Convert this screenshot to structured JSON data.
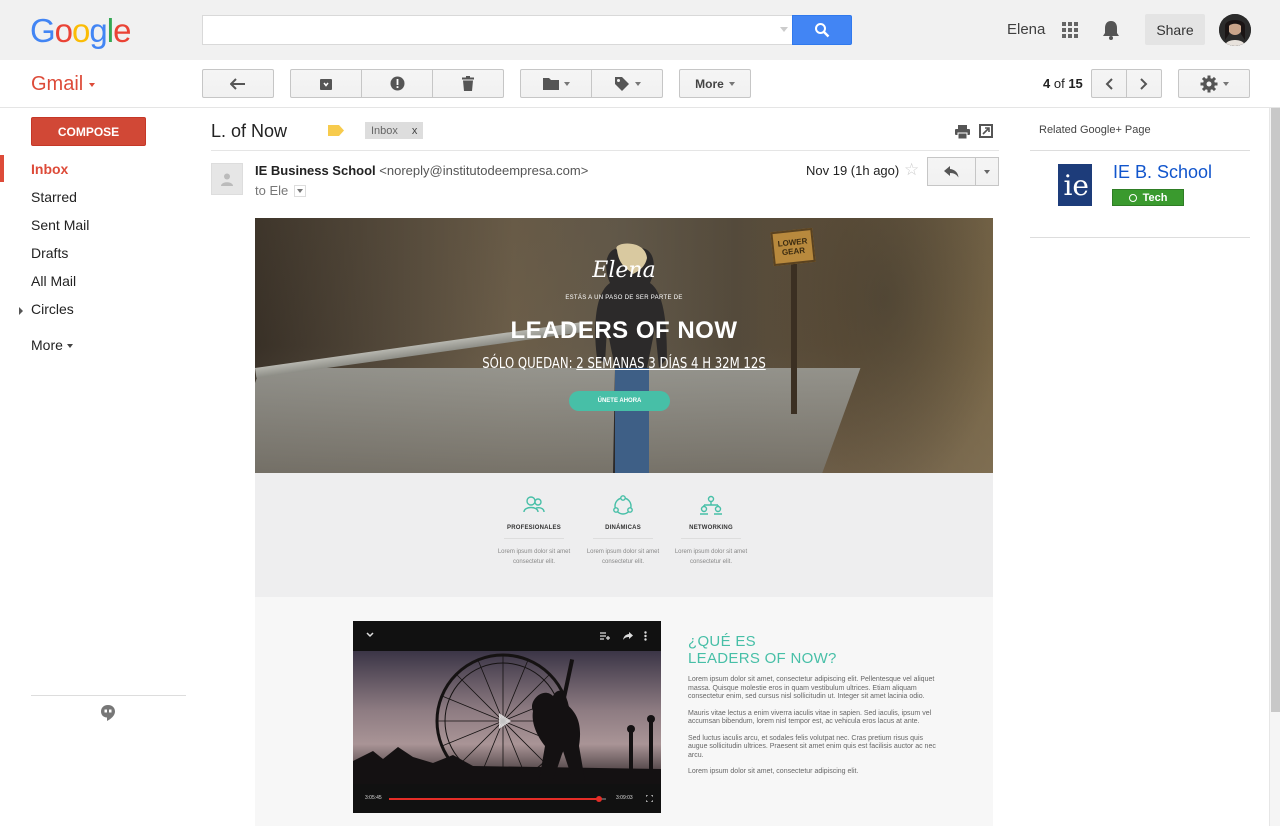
{
  "topbar": {
    "logo_letters": [
      {
        "ch": "G",
        "color": "#4285f4"
      },
      {
        "ch": "o",
        "color": "#ea4335"
      },
      {
        "ch": "o",
        "color": "#fbbc05"
      },
      {
        "ch": "g",
        "color": "#4285f4"
      },
      {
        "ch": "l",
        "color": "#34a853"
      },
      {
        "ch": "e",
        "color": "#ea4335"
      }
    ],
    "search_value": "",
    "user_name": "Elena",
    "share_label": "Share"
  },
  "toolbar": {
    "app_label": "Gmail",
    "more_label": "More",
    "page_current": "4",
    "page_of": "of",
    "page_total": "15"
  },
  "sidebar": {
    "compose_label": "COMPOSE",
    "items": [
      {
        "label": "Inbox"
      },
      {
        "label": "Starred"
      },
      {
        "label": "Sent Mail"
      },
      {
        "label": "Drafts"
      },
      {
        "label": "All Mail"
      },
      {
        "label": "Circles"
      },
      {
        "label": "More"
      }
    ]
  },
  "message": {
    "subject": "L. of Now",
    "label_chip": "Inbox",
    "label_chip_close": "x",
    "sender_name": "IE Business School",
    "sender_email": "<noreply@institutodeempresa.com>",
    "to_line": "to Ele",
    "date": "Nov 19 (1h ago)",
    "star": "☆"
  },
  "email": {
    "hero": {
      "name": "Elena",
      "pretitle": "ESTÁS A UN PASO DE SER PARTE DE",
      "title": "LEADERS OF NOW",
      "count_prefix": "SÓLO QUEDAN:",
      "count_value": "2 SEMANAS 3 DÍAS 4 H 32M 12S",
      "cta": "ÚNETE AHORA",
      "sign_text": "LOWER GEAR"
    },
    "features": [
      {
        "title": "PROFESIONALES",
        "desc1": "Lorem ipsum dolor sit amet",
        "desc2": "consectetur elit."
      },
      {
        "title": "DINÁMICAS",
        "desc1": "Lorem ipsum dolor sit amet",
        "desc2": "consectetur elit."
      },
      {
        "title": "NETWORKING",
        "desc1": "Lorem ipsum dolor sit amet",
        "desc2": "consectetur elit."
      }
    ],
    "video": {
      "time_current": "3:05:45",
      "time_total": "3:09:03",
      "progress": 0.97
    },
    "lower": {
      "title_line1": "¿QUÉ ES",
      "title_line2": "LEADERS OF NOW?",
      "paragraphs": [
        "Lorem ipsum dolor sit amet, consectetur adipiscing elit. Pellentesque vel aliquet massa. Quisque molestie eros in quam vestibulum ultrices. Etiam aliquam consectetur enim, sed cursus nisl sollicitudin ut. Integer sit amet lacinia odio.",
        "Mauris vitae lectus a enim viverra iaculis vitae in sapien. Sed iaculis, ipsum vel accumsan bibendum, lorem nisl tempor est, ac vehicula eros lacus at ante.",
        "Sed luctus iaculis arcu, et sodales felis volutpat nec. Cras pretium risus quis augue sollicitudin ultrices. Praesent sit amet enim quis est facilisis auctor ac nec arcu.",
        "Lorem ipsum dolor sit amet, consectetur adipiscing elit."
      ]
    }
  },
  "right_panel": {
    "related_label": "Related Google+ Page",
    "page_name": "IE B. School",
    "logo_text": "ie",
    "badge": "Tech"
  },
  "colors": {
    "gmail_red": "#dd4b39",
    "search_blue": "#4285f4",
    "accent_teal": "#47bfa7",
    "link_blue": "#1155cc",
    "tech_green": "#3a9a2e"
  }
}
